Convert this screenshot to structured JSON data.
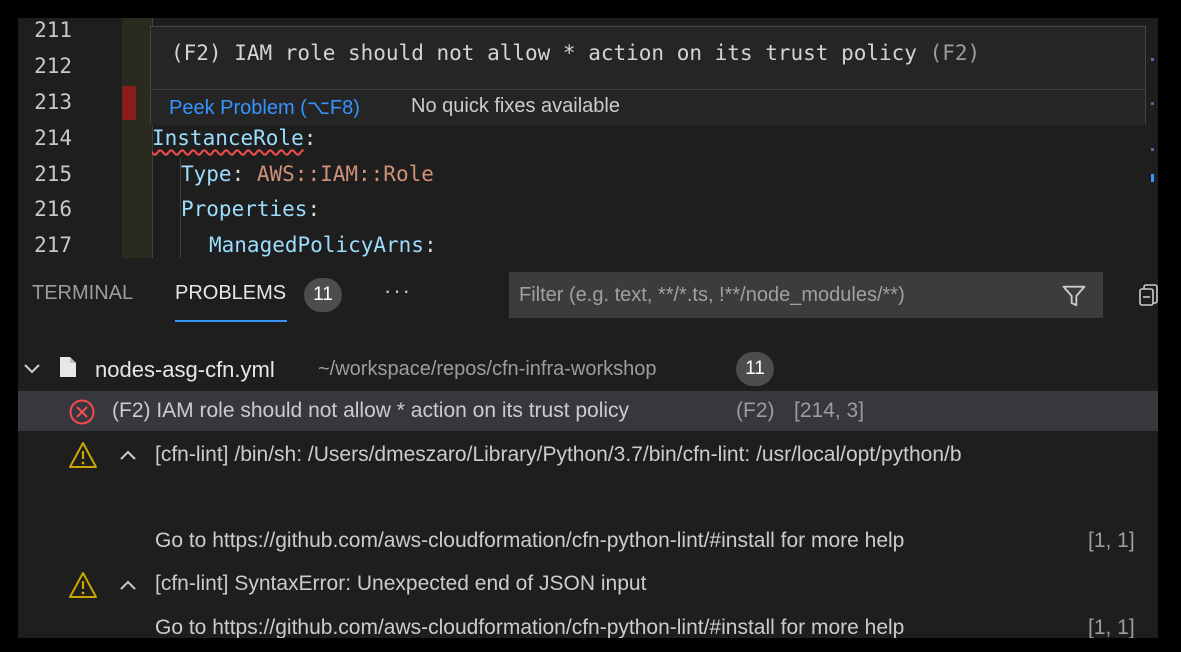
{
  "editor": {
    "lines": [
      {
        "num": "211"
      },
      {
        "num": "212"
      },
      {
        "num": "213"
      },
      {
        "num": "214",
        "key": "InstanceRole",
        "colon": ":"
      },
      {
        "num": "215",
        "key": "Type",
        "colon": ": ",
        "value": "AWS::IAM::Role"
      },
      {
        "num": "216",
        "key": "Properties",
        "colon": ":"
      },
      {
        "num": "217",
        "key": "ManagedPolicyArns",
        "colon": ":"
      }
    ],
    "hover": {
      "message": "(F2) IAM role should not allow * action on its trust policy",
      "code": "(F2)",
      "peek_label": "Peek Problem (⌥F8)",
      "no_fix_label": "No quick fixes available"
    }
  },
  "panel": {
    "tabs": {
      "terminal": "TERMINAL",
      "problems": "PROBLEMS"
    },
    "problem_count": "11",
    "more": "···",
    "filter_placeholder": "Filter (e.g. text, **/*.ts, !**/node_modules/**)",
    "file": {
      "name": "nodes-asg-cfn.yml",
      "path": "~/workspace/repos/cfn-infra-workshop",
      "count": "11"
    },
    "problems": [
      {
        "severity": "error",
        "message": "(F2) IAM role should not allow * action on its trust policy",
        "code": "(F2)",
        "location": "[214, 3]"
      },
      {
        "severity": "warning",
        "message": "[cfn-lint] /bin/sh: /Users/dmeszaro/Library/Python/3.7/bin/cfn-lint: /usr/local/opt/python/b",
        "detail": "Go to https://github.com/aws-cloudformation/cfn-python-lint/#install for more help",
        "location": "[1, 1]"
      },
      {
        "severity": "warning",
        "message": "[cfn-lint] SyntaxError: Unexpected end of JSON input",
        "detail": "Go to https://github.com/aws-cloudformation/cfn-python-lint/#install for more help",
        "location": "[1, 1]"
      }
    ]
  },
  "colors": {
    "error": "#f14c4c",
    "warning": "#cca700",
    "link": "#3794ff",
    "accent": "#3794ff"
  }
}
